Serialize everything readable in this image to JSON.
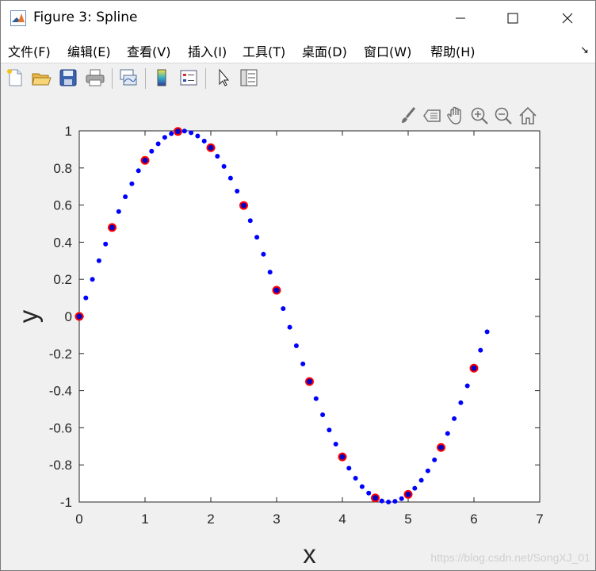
{
  "window": {
    "title": "Figure 3: Spline"
  },
  "menu": [
    "文件(F)",
    "编辑(E)",
    "查看(V)",
    "插入(I)",
    "工具(T)",
    "桌面(D)",
    "窗口(W)",
    "帮助(H)"
  ],
  "icons": {
    "toolbar": [
      "new-figure-icon",
      "open-file-icon",
      "save-icon",
      "print-icon",
      "link-plot-icon",
      "colorbar-icon",
      "legend-icon",
      "pointer-icon",
      "property-inspector-icon"
    ],
    "axes_toolbar": [
      "brush-icon",
      "data-tips-icon",
      "pan-icon",
      "zoom-in-icon",
      "zoom-out-icon",
      "home-icon"
    ]
  },
  "colors": {
    "dense_series": "#0000ff",
    "sample_series_fill": "#0000c8",
    "sample_series_edge": "#ff0000"
  },
  "watermark": "https://blog.csdn.net/SongXJ_01",
  "chart_data": {
    "type": "scatter",
    "xlabel": "x",
    "ylabel": "y",
    "xlim": [
      0,
      7
    ],
    "ylim": [
      -1,
      1
    ],
    "xticks": [
      0,
      1,
      2,
      3,
      4,
      5,
      6,
      7
    ],
    "yticks": [
      1,
      0.8,
      0.6,
      0.4,
      0.2,
      0,
      -0.2,
      -0.4,
      -0.6,
      -0.8,
      -1
    ],
    "grid": false,
    "series": [
      {
        "marker": "dot",
        "x": [
          0,
          0.1,
          0.2,
          0.3,
          0.4,
          0.5,
          0.6,
          0.7,
          0.8,
          0.9,
          1.0,
          1.1,
          1.2,
          1.3,
          1.4,
          1.5,
          1.6,
          1.7,
          1.8,
          1.9,
          2.0,
          2.1,
          2.2,
          2.3,
          2.4,
          2.5,
          2.6,
          2.7,
          2.8,
          2.9,
          3.0,
          3.1,
          3.2,
          3.3,
          3.4,
          3.5,
          3.6,
          3.7,
          3.8,
          3.9,
          4.0,
          4.1,
          4.2,
          4.3,
          4.4,
          4.5,
          4.6,
          4.7,
          4.8,
          4.9,
          5.0,
          5.1,
          5.2,
          5.3,
          5.4,
          5.5,
          5.6,
          5.7,
          5.8,
          5.9,
          6.0,
          6.1,
          6.2
        ],
        "y": [
          0,
          0.1,
          0.2,
          0.3,
          0.39,
          0.48,
          0.565,
          0.645,
          0.715,
          0.785,
          0.84,
          0.89,
          0.93,
          0.965,
          0.985,
          0.997,
          0.999,
          0.99,
          0.972,
          0.945,
          0.909,
          0.863,
          0.808,
          0.745,
          0.675,
          0.599,
          0.516,
          0.427,
          0.335,
          0.239,
          0.141,
          0.042,
          -0.058,
          -0.158,
          -0.256,
          -0.351,
          -0.443,
          -0.53,
          -0.612,
          -0.688,
          -0.757,
          -0.818,
          -0.872,
          -0.917,
          -0.952,
          -0.978,
          -0.994,
          -1.0,
          -0.996,
          -0.982,
          -0.959,
          -0.926,
          -0.883,
          -0.832,
          -0.773,
          -0.706,
          -0.631,
          -0.551,
          -0.465,
          -0.374,
          -0.279,
          -0.182,
          -0.083
        ]
      },
      {
        "marker": "circle",
        "x": [
          0,
          0.5,
          1,
          1.5,
          2,
          2.5,
          3,
          3.5,
          4,
          4.5,
          5,
          5.5,
          6
        ],
        "y": [
          0,
          0.479,
          0.841,
          0.997,
          0.909,
          0.598,
          0.141,
          -0.351,
          -0.757,
          -0.978,
          -0.959,
          -0.706,
          -0.279
        ]
      }
    ]
  }
}
